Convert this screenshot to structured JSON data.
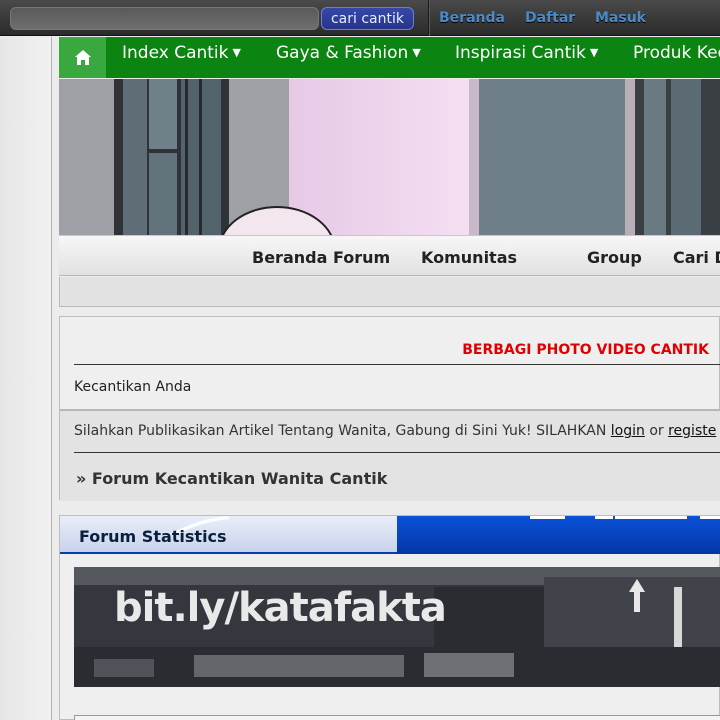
{
  "topbar": {
    "search_placeholder": "",
    "search_button": "cari cantik",
    "links": [
      "Beranda",
      "Daftar",
      "Masuk"
    ]
  },
  "greennav": {
    "home_icon": "home-icon",
    "items": [
      "Index Cantik",
      "Gaya & Fashion",
      "Inspirasi Cantik",
      "Produk Kec"
    ]
  },
  "forumnav": {
    "items": [
      "Beranda Forum",
      "Komunitas",
      "Group",
      "Cari D"
    ]
  },
  "intro": {
    "headline": "BERBAGI PHOTO VIDEO CANTIK",
    "tagline": "Kecantikan Anda",
    "welcome_text": "Silahkan Publikasikan Artikel Tentang Wanita, Gabung di Sini Yuk!   SILAHKAN ",
    "login_link": "login",
    "or_text": " or ",
    "register_link": "registe",
    "breadcrumb": "» Forum Kecantikan Wanita Cantik"
  },
  "stats": {
    "title": "Forum Statistics",
    "banner_text": "bit.ly/katafakta"
  },
  "colors": {
    "nav_green": "#0c8412",
    "home_green": "#39a83e",
    "headline_red": "#e00000",
    "link_blue": "#4a8bc6",
    "stats_blue": "#0a52d8"
  }
}
